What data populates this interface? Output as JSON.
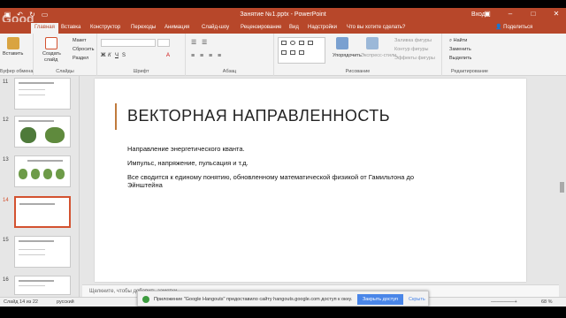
{
  "titlebar": {
    "document_title": "Занятие №1.pptx  -  PowerPoint",
    "user": "Вход",
    "watermark": "Goog"
  },
  "tabs": [
    {
      "label": "Главная",
      "active": true
    },
    {
      "label": "Вставка"
    },
    {
      "label": "Конструктор"
    },
    {
      "label": "Переходы"
    },
    {
      "label": "Анимация"
    },
    {
      "label": "Слайд-шоу"
    },
    {
      "label": "Рецензирование"
    },
    {
      "label": "Вид"
    },
    {
      "label": "Надстройки"
    },
    {
      "label": "Что вы хотите сделать?"
    }
  ],
  "share_label": "Поделиться",
  "ribbon": {
    "clipboard": {
      "paste": "Вставить",
      "label": "Буфер обмена"
    },
    "slides": {
      "create": "Создать",
      "create2": "слайд",
      "layout": "Макет",
      "reset": "Сбросить",
      "section": "Раздел",
      "label": "Слайды"
    },
    "font": {
      "label": "Шрифт"
    },
    "paragraph": {
      "label": "Абзац"
    },
    "drawing": {
      "arrange": "Упорядочить",
      "quick_styles": "Экспресс-стили",
      "fill": "Заливка фигуры",
      "outline": "Контур фигуры",
      "effects": "Эффекты фигуры",
      "label": "Рисование"
    },
    "editing": {
      "find": "Найти",
      "replace": "Заменить",
      "select": "Выделить",
      "label": "Редактирование"
    }
  },
  "thumbnails": [
    {
      "num": "11"
    },
    {
      "num": "12"
    },
    {
      "num": "13"
    },
    {
      "num": "14",
      "active": true
    },
    {
      "num": "15"
    },
    {
      "num": "16"
    }
  ],
  "slide": {
    "title": "ВЕКТОРНАЯ НАПРАВЛЕННОСТЬ",
    "lines": [
      "Направление энергетического кванта.",
      "Импульс, напряжение, пульсация и т.д.",
      "Все сводится к единому понятию, обновленному математической физикой от Гамильтона до Эйнштейна"
    ]
  },
  "notes_placeholder": "Щелкните, чтобы добавить заметки",
  "hangouts": {
    "message": "Приложение \"Google Hangouts\" предоставило сайту hangouts.google.com доступ к окну.",
    "share_btn": "Закрыть доступ",
    "hide_btn": "Скрыть"
  },
  "status": {
    "slide_counter": "Слайд 14 из 22",
    "language": "русский",
    "zoom": "68 %"
  },
  "colors": {
    "accent": "#b7472a",
    "active_thumb": "#d35230",
    "title_bar_line": "#c07a3c"
  }
}
